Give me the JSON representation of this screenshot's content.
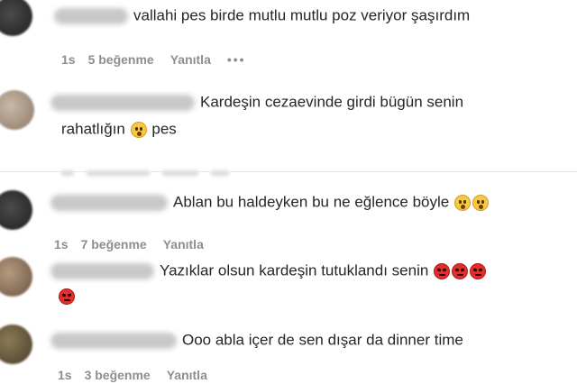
{
  "comments": [
    {
      "text": "vallahi pes birde mutlu mutlu poz veriyor şaşırdım",
      "time": "1s",
      "likes": "5 beğenme",
      "reply": "Yanıtla",
      "more": "•••"
    },
    {
      "text_line1": "Kardeşin cezaevinde girdi bügün senin",
      "text_line2_a": "rahatlığın",
      "text_line2_b": "pes",
      "emoji": "astonished-face-icon"
    },
    {
      "text": "Ablan bu haldeyken bu ne eğlence böyle",
      "emojis": [
        "astonished-face-icon",
        "astonished-face-icon"
      ],
      "time": "1s",
      "likes": "7 beğenme",
      "reply": "Yanıtla"
    },
    {
      "text": "Yazıklar olsun kardeşin tutuklandı senin",
      "emojis": [
        "angry-face-icon",
        "angry-face-icon",
        "angry-face-icon",
        "angry-face-icon"
      ]
    },
    {
      "text": "Ooo abla içer de sen dışar da dinner time",
      "time": "1s",
      "likes": "3 beğenme",
      "reply": "Yanıtla"
    }
  ]
}
